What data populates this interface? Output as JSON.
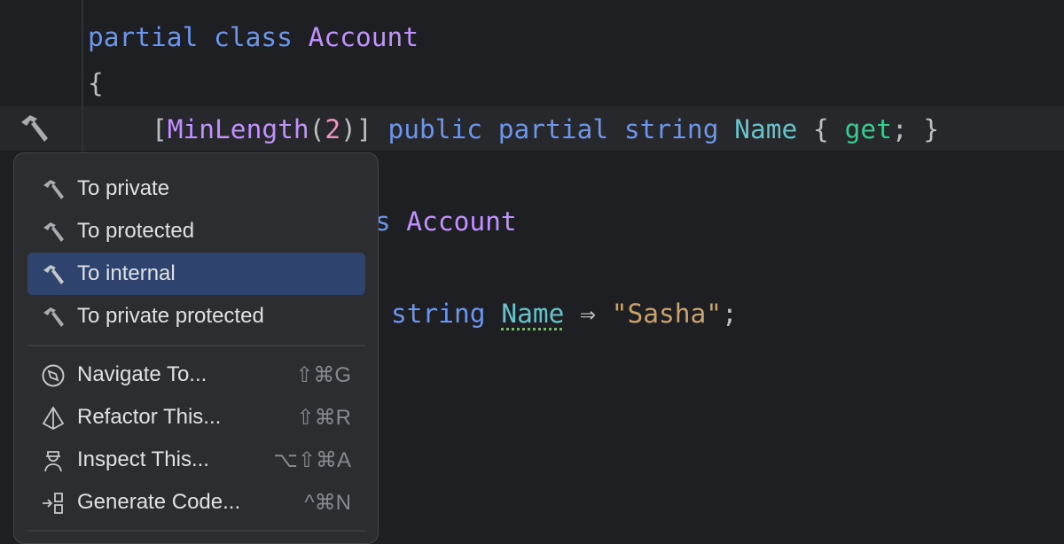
{
  "editor": {
    "line1": {
      "kw1": "partial",
      "kw2": "class",
      "name": "Account"
    },
    "line2": {
      "brace": "{"
    },
    "line3": {
      "lb": "[",
      "attr": "MinLength",
      "lp": "(",
      "num": "2",
      "rp": ")]",
      "kw1": "public",
      "kw2": "partial",
      "kw3": "string",
      "prop": "Name",
      "ob": "{",
      "acc": "get",
      "rest": "; }"
    },
    "line4": {
      "kw": "ss",
      "name": "Account"
    },
    "line5": {
      "kw": "string",
      "prop": "Name",
      "arrow": "⇒",
      "str": "\"Sasha\"",
      "semi": ";"
    },
    "gutter_icon": "hammer-icon"
  },
  "context_menu": {
    "items": [
      {
        "label": "To private",
        "icon": "hammer-icon"
      },
      {
        "label": "To protected",
        "icon": "hammer-icon"
      },
      {
        "label": "To internal",
        "icon": "hammer-icon",
        "selected": true
      },
      {
        "label": "To private protected",
        "icon": "hammer-icon"
      },
      {
        "label": "Navigate To...",
        "icon": "compass-icon",
        "shortcut": "⇧⌘G"
      },
      {
        "label": "Refactor This...",
        "icon": "prism-icon",
        "shortcut": "⇧⌘R"
      },
      {
        "label": "Inspect This...",
        "icon": "inspector-icon",
        "shortcut": "⌥⇧⌘A"
      },
      {
        "label": "Generate Code...",
        "icon": "generate-icon",
        "shortcut": "^⌘N"
      }
    ],
    "colors": {
      "selected": "#2e436e",
      "background": "#2b2d30"
    }
  }
}
